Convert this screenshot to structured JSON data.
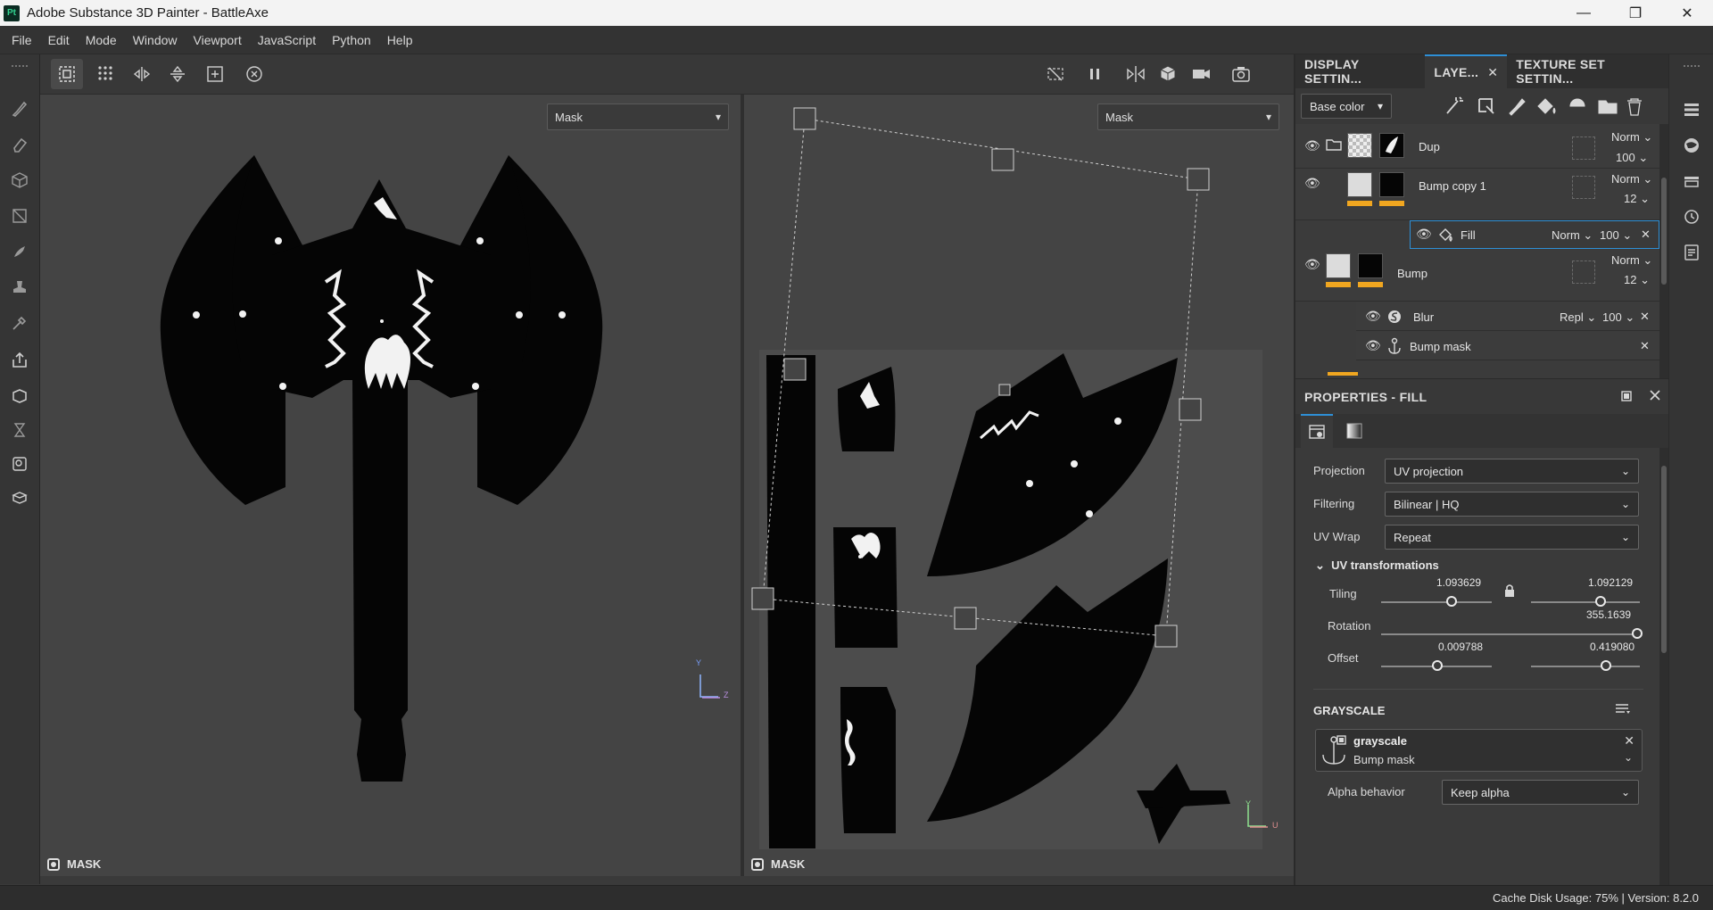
{
  "window": {
    "app_icon_text": "Pt",
    "title": "Adobe Substance 3D Painter - BattleAxe",
    "minimize": "—",
    "maximize": "❐",
    "close": "✕"
  },
  "menu": [
    "File",
    "Edit",
    "Mode",
    "Window",
    "Viewport",
    "JavaScript",
    "Python",
    "Help"
  ],
  "viewport_left": {
    "channel": "Mask",
    "label": "MASK",
    "axis_y": "Y",
    "axis_z": "Z"
  },
  "viewport_right": {
    "channel": "Mask",
    "label": "MASK",
    "axis_y": "Y",
    "axis_u": "U"
  },
  "tabs": {
    "display": "DISPLAY SETTIN...",
    "layers": "LAYE...",
    "layers_close": "✕",
    "texture_set": "TEXTURE SET SETTIN..."
  },
  "layer_toolbar": {
    "channel": "Base color"
  },
  "layers": [
    {
      "name": "Dup",
      "blend": "Norm",
      "opacity": "100"
    },
    {
      "name": "Bump copy 1",
      "blend": "Norm",
      "opacity": "12"
    },
    {
      "name": "Fill",
      "blend": "Norm",
      "opacity": "100",
      "remove": "✕"
    },
    {
      "name": "Bump",
      "blend": "Norm",
      "opacity": "12"
    },
    {
      "name": "Blur",
      "blend": "Repl",
      "opacity": "100",
      "remove": "✕"
    },
    {
      "name": "Bump mask",
      "remove": "✕"
    }
  ],
  "properties": {
    "title": "PROPERTIES - FILL",
    "projection_label": "Projection",
    "projection_value": "UV projection",
    "filtering_label": "Filtering",
    "filtering_value": "Bilinear | HQ",
    "uvwrap_label": "UV Wrap",
    "uvwrap_value": "Repeat",
    "uv_section": "UV transformations",
    "tiling_label": "Tiling",
    "tiling_u": "1.093629",
    "tiling_v": "1.092129",
    "rotation_label": "Rotation",
    "rotation_value": "355.1639",
    "offset_label": "Offset",
    "offset_u": "0.009788",
    "offset_v": "0.419080",
    "grayscale_section": "GRAYSCALE",
    "grayscale_name": "grayscale",
    "grayscale_source": "Bump mask",
    "alpha_label": "Alpha behavior",
    "alpha_value": "Keep alpha"
  },
  "slider_levels": {
    "tiling_u": 0.64,
    "tiling_v": 0.64,
    "rotation": 0.99,
    "offset_u": 0.51,
    "offset_v": 0.69
  },
  "status": "Cache Disk Usage:  75% | Version: 8.2.0",
  "colors": {
    "accent_blue": "#2e8fd6",
    "channel_yellow": "#f0a620",
    "viewport_bg": "#444444",
    "mask_black": "#050505"
  }
}
